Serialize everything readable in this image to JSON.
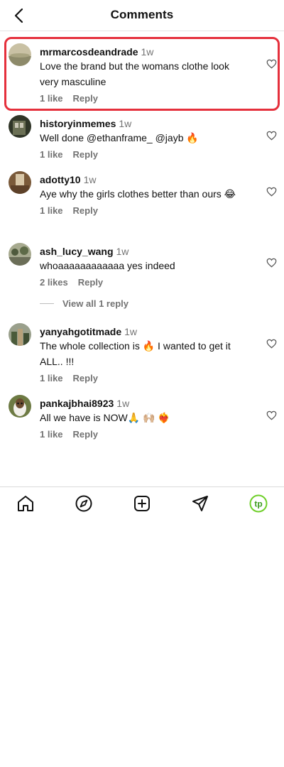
{
  "header": {
    "title": "Comments"
  },
  "comments": [
    {
      "username": "mrmarcosdeandrade",
      "time": "1w",
      "text": "Love the brand but the womans clothe look very masculine",
      "likes": "1 like",
      "reply": "Reply"
    },
    {
      "username": "historyinmemes",
      "time": "1w",
      "text": "Well done @ethanframe_ @jayb 🔥",
      "likes": "1 like",
      "reply": "Reply"
    },
    {
      "username": "adotty10",
      "time": "1w",
      "text": "Aye why the girls clothes better than ours 😂",
      "likes": "1 like",
      "reply": "Reply"
    },
    {
      "username": "ash_lucy_wang",
      "time": "1w",
      "text": "whoaaaaaaaaaaaa yes indeed",
      "likes": "2 likes",
      "reply": "Reply"
    },
    {
      "username": "yanyahgotitmade",
      "time": "1w",
      "text": "The whole collection is 🔥 I wanted to get it ALL.. !!!",
      "likes": "1 like",
      "reply": "Reply"
    },
    {
      "username": "pankajbhai8923",
      "time": "1w",
      "text": "All we have is NOW🙏 🙌🏼 ❤️‍🔥",
      "likes": "1 like",
      "reply": "Reply"
    }
  ],
  "view_replies": "View all 1 reply",
  "nav": {
    "profile_initials": "tp"
  },
  "colors": {
    "highlight": "#e5303c",
    "profile_ring": "#6fcf2a",
    "muted": "#737373"
  }
}
